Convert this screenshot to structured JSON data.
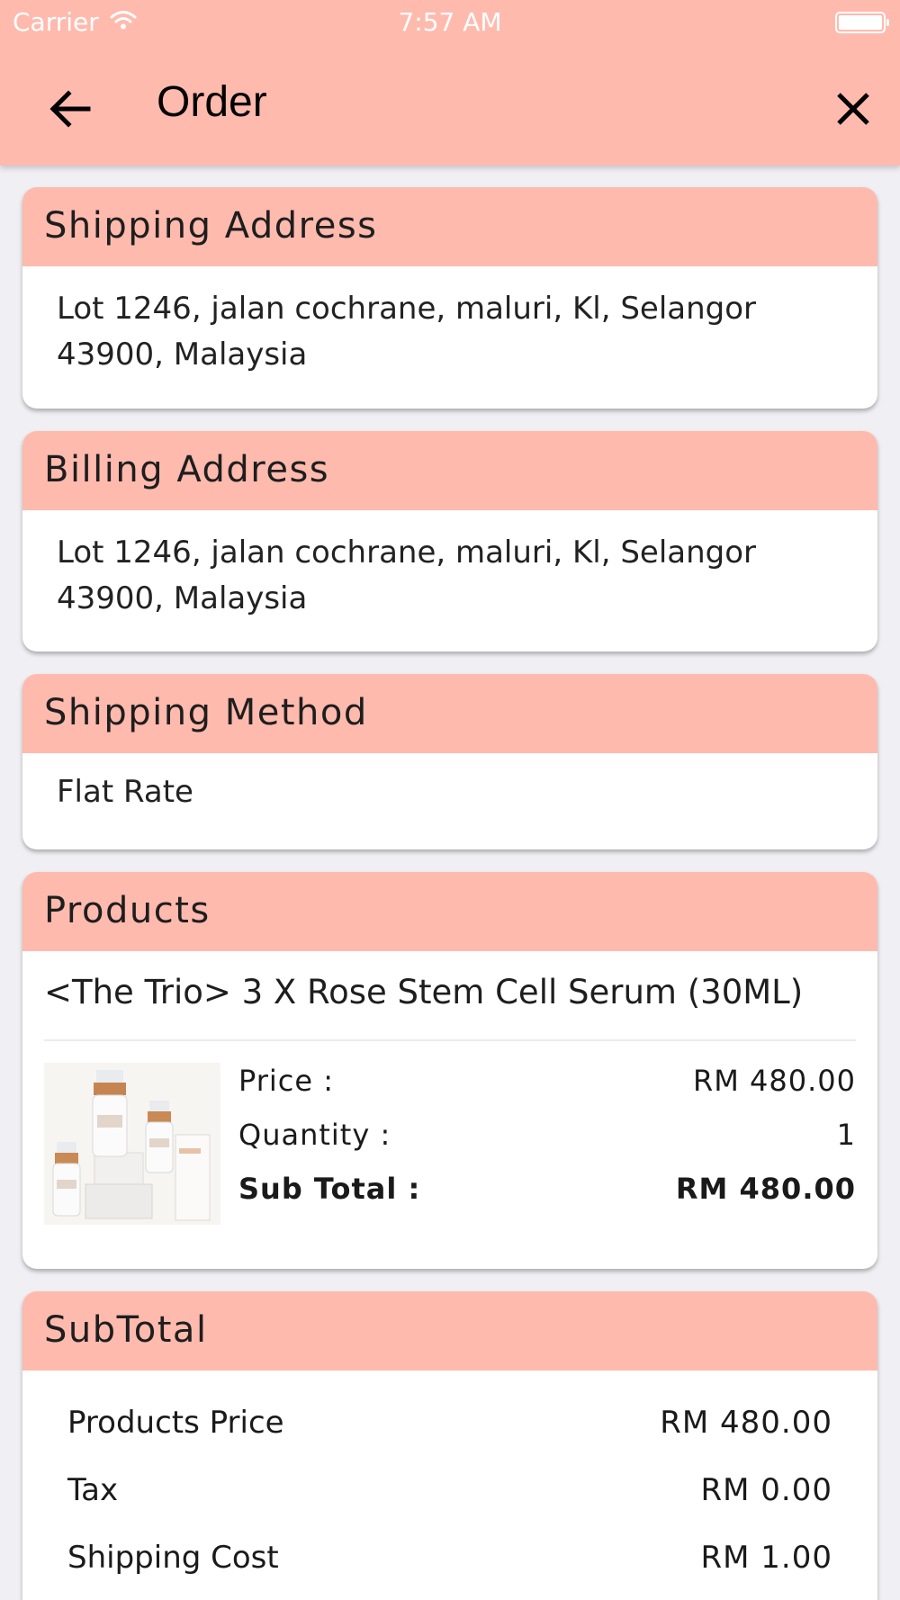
{
  "status_bar": {
    "carrier": "Carrier",
    "time": "7:57 AM"
  },
  "header": {
    "title": "Order",
    "back_icon": "arrow-left-icon",
    "close_icon": "close-icon"
  },
  "colors": {
    "accent": "#ffbaae",
    "background": "#efeff4",
    "card": "#ffffff"
  },
  "shipping_address": {
    "title": "Shipping Address",
    "line1": "Lot 1246, jalan cochrane, maluri, Kl, Selangor",
    "line2": "43900, Malaysia"
  },
  "billing_address": {
    "title": "Billing Address",
    "line1": "Lot 1246, jalan cochrane, maluri, Kl, Selangor",
    "line2": "43900, Malaysia"
  },
  "shipping_method": {
    "title": "Shipping Method",
    "value": "Flat Rate"
  },
  "products": {
    "title": "Products",
    "items": [
      {
        "name": "<The Trio> 3 X Rose Stem Cell Serum (30ML)",
        "price_label": "Price :",
        "price": "RM 480.00",
        "quantity_label": "Quantity :",
        "quantity": "1",
        "subtotal_label": "Sub Total :",
        "subtotal": "RM 480.00"
      }
    ]
  },
  "subtotal": {
    "title": "SubTotal",
    "rows": [
      {
        "label": "Products Price",
        "value": "RM 480.00"
      },
      {
        "label": "Tax",
        "value": "RM 0.00"
      },
      {
        "label": "Shipping Cost",
        "value": "RM 1.00"
      }
    ]
  }
}
